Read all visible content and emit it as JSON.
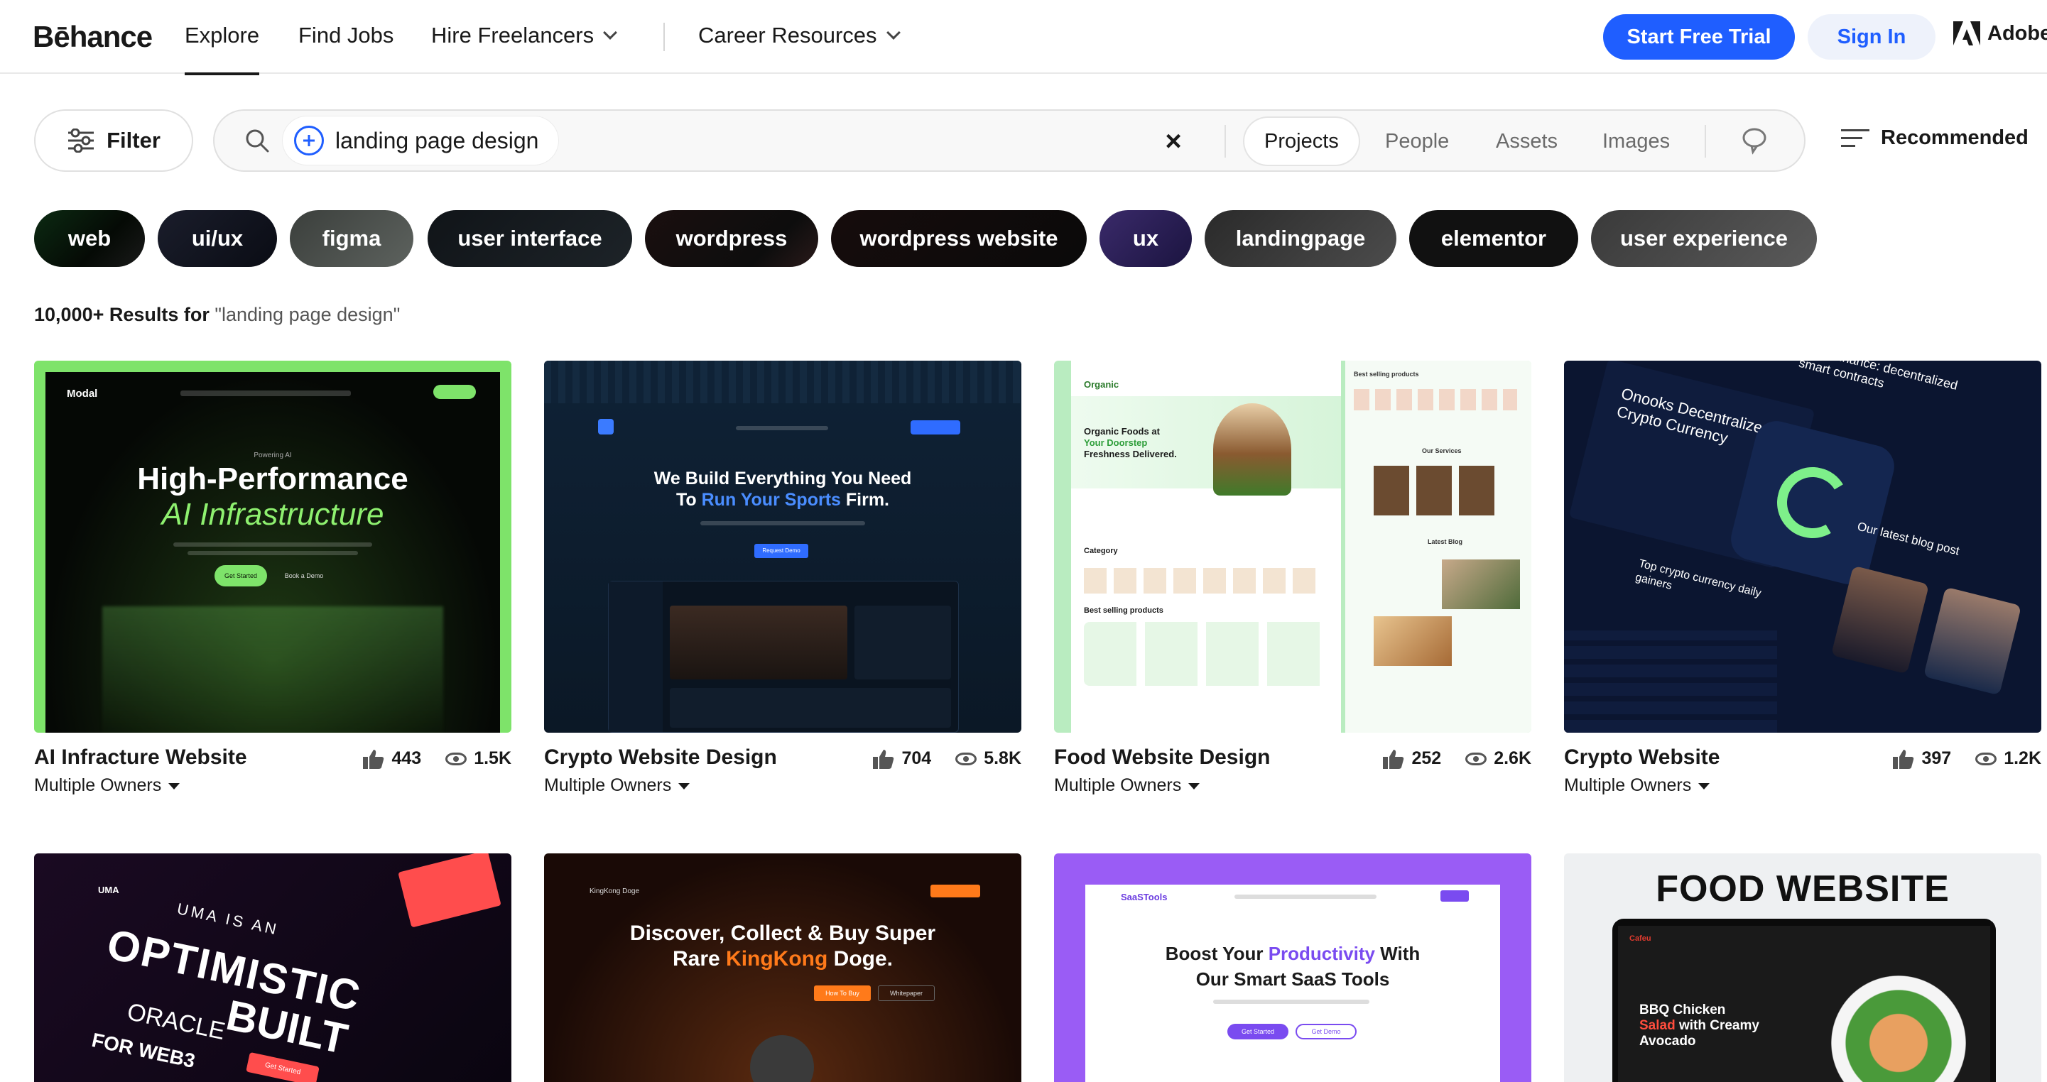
{
  "header": {
    "logo": "Bēhance",
    "nav": [
      {
        "label": "Explore",
        "active": true
      },
      {
        "label": "Find Jobs"
      },
      {
        "label": "Hire Freelancers",
        "dropdown": true
      },
      {
        "label": "Career Resources",
        "dropdown": true
      }
    ],
    "start_trial": "Start Free Trial",
    "sign_in": "Sign In",
    "adobe": "Adobe"
  },
  "search": {
    "filter_label": "Filter",
    "query": "landing page design",
    "clear_icon": "close-icon",
    "tabs": [
      "Projects",
      "People",
      "Assets",
      "Images"
    ],
    "active_tab": "Projects",
    "sort_label": "Recommended"
  },
  "tags": [
    "web",
    "ui/ux",
    "figma",
    "user interface",
    "wordpress",
    "wordpress website",
    "ux",
    "landingpage",
    "elementor",
    "user experience"
  ],
  "results": {
    "count": "10,000+ Results for",
    "query_quoted": "\"landing page design\""
  },
  "cards": [
    {
      "title": "AI Infracture Website",
      "owners": "Multiple Owners",
      "likes": "443",
      "views": "1.5K",
      "thumb": {
        "brand": "Modal",
        "kicker": "Powering AI",
        "h1": "High-Performance",
        "h2": "AI Infrastructure",
        "cta1": "Get Started",
        "cta2": "Book a Demo"
      }
    },
    {
      "title": "Crypto Website Design",
      "owners": "Multiple Owners",
      "likes": "704",
      "views": "5.8K",
      "thumb": {
        "h1": "We Build Everything You Need",
        "h2a": "To ",
        "h2b": "Run Your Sports",
        "h2c": " Firm.",
        "cta": "Request Demo"
      }
    },
    {
      "title": "Food Website Design",
      "owners": "Multiple Owners",
      "likes": "252",
      "views": "2.6K",
      "thumb": {
        "brand": "Organic",
        "h1": "Organic Foods at",
        "h2": "Your Doorstep",
        "h3": "Freshness Delivered.",
        "section1": "Category",
        "section2": "Best selling products",
        "side1": "Best selling products",
        "side2": "Our Services",
        "side3": "Latest Blog"
      }
    },
    {
      "title": "Crypto Website",
      "owners": "Multiple Owners",
      "likes": "397",
      "views": "1.2K",
      "thumb": {
        "t1": "Onooks Decentralized Crypto Currency",
        "t2": "Open finance: decentralized smart contracts",
        "t3": "Our latest blog post",
        "t4": "Top crypto currency daily gainers"
      }
    },
    {
      "thumb": {
        "brand": "UMA",
        "l1": "UMA IS AN",
        "l2": "OPTIMISTIC",
        "l3": "ORACLE",
        "l4": "BUILT",
        "l5": "FOR WEB3",
        "cta": "Get Started"
      }
    },
    {
      "thumb": {
        "brand": "KingKong Doge",
        "l1": "Discover, Collect & Buy Super",
        "l2a": "Rare ",
        "l2b": "KingKong",
        "l2c": " Doge.",
        "cta1": "How To Buy",
        "cta2": "Whitepaper"
      }
    },
    {
      "thumb": {
        "brand": "SaaSTools",
        "l1a": "Boost Your ",
        "l1b": "Productivity",
        "l1c": " With",
        "l2": "Our Smart SaaS Tools",
        "cta1": "Get Started",
        "cta2": "Get Demo"
      }
    },
    {
      "thumb": {
        "title": "FOOD WEBSITE",
        "brand": "Cafeu",
        "l1": "BBQ Chicken",
        "l2a": "Salad",
        "l2b": " with Creamy",
        "l3": "Avocado"
      }
    }
  ],
  "colors": {
    "accent": "#1f5eff",
    "text": "#191919"
  }
}
